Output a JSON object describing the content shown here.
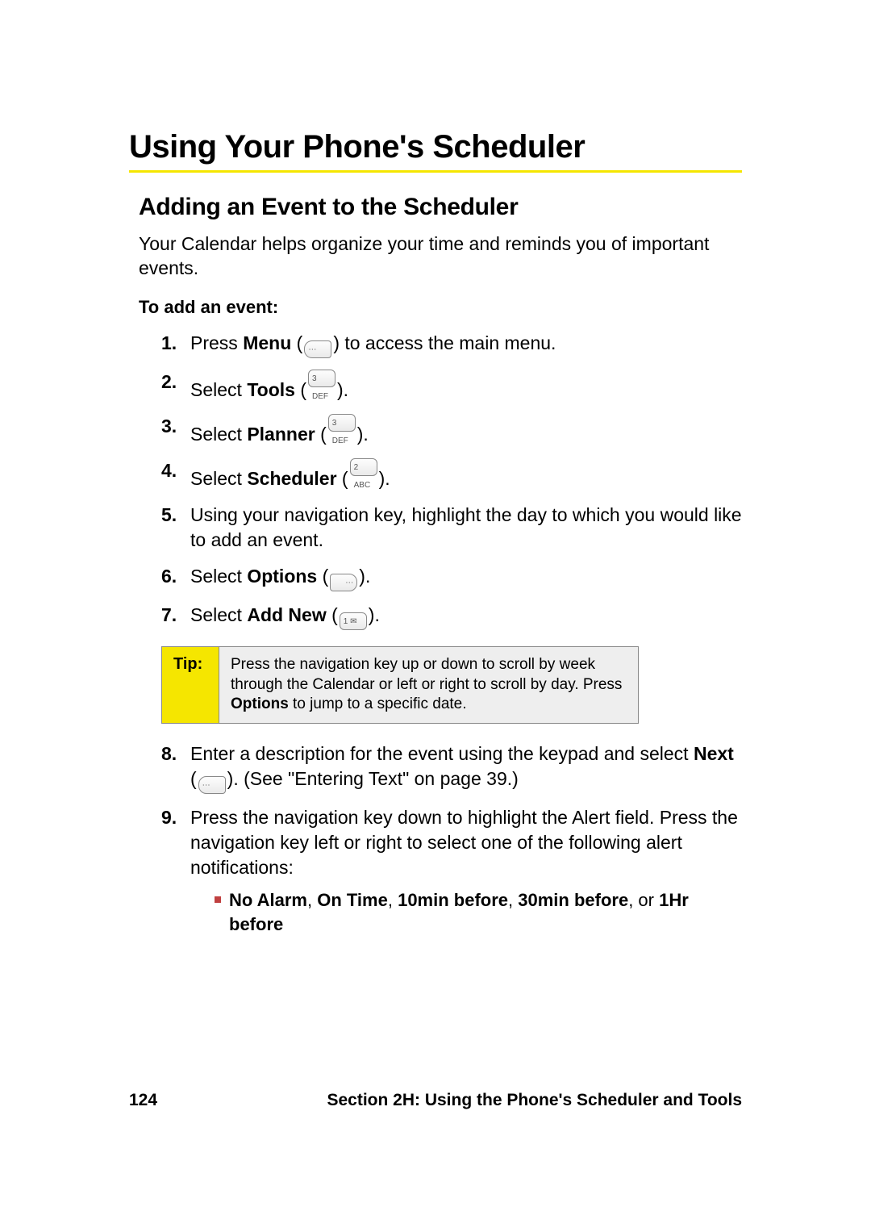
{
  "title": "Using Your Phone's Scheduler",
  "subtitle": "Adding an Event to the Scheduler",
  "intro": "Your Calendar helps organize your time and reminds you of important events.",
  "lead": "To add an event:",
  "steps": {
    "s1_num": "1.",
    "s1_a": "Press ",
    "s1_bold": "Menu",
    "s1_b": " (",
    "s1_key": "⋯",
    "s1_c": ") to access the main menu.",
    "s2_num": "2.",
    "s2_a": "Select ",
    "s2_bold": "Tools",
    "s2_b": " (",
    "s2_key": "3 DEF",
    "s2_c": ").",
    "s3_num": "3.",
    "s3_a": "Select ",
    "s3_bold": "Planner",
    "s3_b": " (",
    "s3_key": "3 DEF",
    "s3_c": ").",
    "s4_num": "4.",
    "s4_a": "Select ",
    "s4_bold": "Scheduler",
    "s4_b": " (",
    "s4_key": "2 ABC",
    "s4_c": ").",
    "s5_num": "5.",
    "s5_text": "Using your navigation key, highlight the day to which you would like to add an event.",
    "s6_num": "6.",
    "s6_a": "Select ",
    "s6_bold": "Options",
    "s6_b": " (",
    "s6_key": "⋯",
    "s6_c": ").",
    "s7_num": "7.",
    "s7_a": "Select ",
    "s7_bold": "Add New",
    "s7_b": " (",
    "s7_key": "1 ✉",
    "s7_c": ").",
    "s8_num": "8.",
    "s8_a": "Enter a description for the event using the keypad and select ",
    "s8_bold": "Next",
    "s8_b": " (",
    "s8_key": "⋯",
    "s8_c": "). (See \"Entering Text\" on page 39.)",
    "s9_num": "9.",
    "s9_text": "Press the navigation key down to highlight the Alert field. Press the navigation key left or right to select one of the following alert notifications:"
  },
  "tip": {
    "label": "Tip:",
    "text_a": "Press the navigation key up or down to scroll by week through the Calendar or left or right to scroll by day. Press ",
    "text_bold": "Options",
    "text_b": " to jump to a specific date."
  },
  "bullet": {
    "b1": "No Alarm",
    "c1": ", ",
    "b2": "On Time",
    "c2": ", ",
    "b3": "10min before",
    "c3": ", ",
    "b4": "30min before",
    "c4": ", or ",
    "b5": "1Hr before"
  },
  "footer": {
    "page": "124",
    "section": "Section 2H: Using the Phone's Scheduler and Tools"
  }
}
